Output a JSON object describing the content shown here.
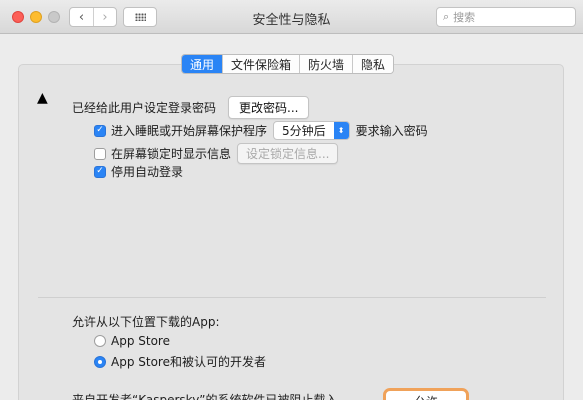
{
  "window": {
    "title": "安全性与隐私"
  },
  "toolbar": {
    "back_icon": "‹",
    "forward_icon": "›",
    "grid_icon": "grid-icon",
    "search_placeholder": "搜索",
    "search_icon": "⌕"
  },
  "tabs": [
    {
      "label": "通用",
      "active": true
    },
    {
      "label": "文件保险箱",
      "active": false
    },
    {
      "label": "防火墙",
      "active": false
    },
    {
      "label": "隐私",
      "active": false
    }
  ],
  "general": {
    "password_label": "已经给此用户设定登录密码",
    "change_password_button": "更改密码...",
    "require_password": {
      "checked": true,
      "label": "进入睡眠或开始屏幕保护程序",
      "select_value": "5分钟后",
      "suffix": "要求输入密码"
    },
    "lock_message": {
      "checked": false,
      "label": "在屏幕锁定时显示信息",
      "button": "设定锁定信息..."
    },
    "disable_autologin": {
      "checked": true,
      "label": "停用自动登录"
    }
  },
  "downloads": {
    "heading": "允许从以下位置下载的App:",
    "options": [
      {
        "label": "App Store",
        "selected": false
      },
      {
        "label": "App Store和被认可的开发者",
        "selected": true
      }
    ],
    "cut_off_text": "来自开发者“Kaspersky”的系统软件已被阻止载入",
    "allow_button": "允许"
  },
  "colors": {
    "accent": "#2a84f5",
    "highlight": "#f0a25a"
  }
}
